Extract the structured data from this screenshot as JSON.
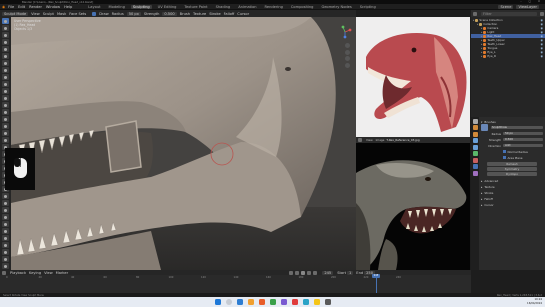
{
  "window": {
    "title": "Blender [C:\\Users\\...\\Rex_Sculpt\\Dino_Head_v12.blend]",
    "controls": "–  ▢  ✕"
  },
  "menubar": {
    "menus": [
      "File",
      "Edit",
      "Render",
      "Window",
      "Help"
    ],
    "workspaces": [
      "Layout",
      "Modeling",
      "Sculpting",
      "UV Editing",
      "Texture Paint",
      "Shading",
      "Animation",
      "Rendering",
      "Compositing",
      "Geometry Nodes",
      "Scripting"
    ],
    "active_workspace": "Sculpting",
    "scene": "Scene",
    "view_layer": "ViewLayer"
  },
  "viewport_header": {
    "mode": "Sculpt Mode",
    "menus": [
      "View",
      "Sculpt",
      "Mask",
      "Face Sets"
    ],
    "brush": "Draw",
    "radius_label": "Radius",
    "radius": "50 px",
    "strength_label": "Strength",
    "strength": "0.500",
    "brush_menu": "Brush",
    "texture_menu": "Texture",
    "stroke_menu": "Stroke",
    "falloff_menu": "Falloff",
    "cursor_menu": "Cursor"
  },
  "viewport": {
    "info_line1": "User Perspective",
    "info_line2": "(1) Rex_Head",
    "info_line3": "Objects 1/3",
    "brush_cursor_color": "#b85550"
  },
  "reference_top": {
    "title": "Reference"
  },
  "reference_bottom_header": {
    "menus": [
      "View",
      "Image"
    ],
    "filename": "T-Rex_Reference_03.jpg"
  },
  "outliner": {
    "search_placeholder": "Filter",
    "rows": [
      {
        "label": "Scene Collection",
        "indent": 0,
        "selected": false
      },
      {
        "label": "Collection",
        "indent": 1,
        "selected": false
      },
      {
        "label": "Camera",
        "indent": 2,
        "selected": false
      },
      {
        "label": "Light",
        "indent": 2,
        "selected": false
      },
      {
        "label": "Rex_Head",
        "indent": 2,
        "selected": true
      },
      {
        "label": "Teeth_Upper",
        "indent": 2,
        "selected": false
      },
      {
        "label": "Teeth_Lower",
        "indent": 2,
        "selected": false
      },
      {
        "label": "Tongue",
        "indent": 2,
        "selected": false
      },
      {
        "label": "Eye_L",
        "indent": 2,
        "selected": false
      },
      {
        "label": "Eye_R",
        "indent": 2,
        "selected": false
      }
    ]
  },
  "properties": {
    "section": "Brushes",
    "brush_name": "SculptDraw",
    "fields": [
      {
        "label": "Radius",
        "value": "50 px"
      },
      {
        "label": "Strength",
        "value": "0.500"
      },
      {
        "label": "Direction",
        "value": "Add"
      }
    ],
    "checkboxes": [
      "Normal Radius",
      "Area Plane"
    ],
    "sections": [
      "Advanced",
      "Texture",
      "Stroke",
      "Falloff",
      "Cursor"
    ],
    "buttons": [
      "Remesh",
      "Symmetry",
      "Dyntopo"
    ],
    "tab_colors": [
      "#aaaaaa",
      "#d18a3a",
      "#d18a3a",
      "#6aa0d8",
      "#6aa0d8",
      "#5bb86a",
      "#c86060",
      "#4772b3",
      "#a070c0"
    ]
  },
  "timeline": {
    "menus": [
      "Playback",
      "Keying",
      "View",
      "Marker"
    ],
    "current_frame": "245",
    "start_label": "Start",
    "start": "1",
    "end_label": "End",
    "end": "250",
    "ticks": [
      "0",
      "20",
      "40",
      "60",
      "80",
      "100",
      "120",
      "140",
      "160",
      "180",
      "200",
      "220",
      "240"
    ]
  },
  "statusbar": {
    "left": "Select   Rotate View   Sculpt Menu",
    "right": "Rex_Head | Verts 1,248,511 | 3.6.2"
  },
  "taskbar": {
    "icon_colors": [
      "#2d7dd2",
      "#f0a030",
      "#e85d2a",
      "#3aa04a",
      "#7a5bd1",
      "#e03c3c",
      "#2aa3c7",
      "#f5c518",
      "#5a5a5a"
    ],
    "time": "10:24",
    "date": "16/04/2024"
  }
}
